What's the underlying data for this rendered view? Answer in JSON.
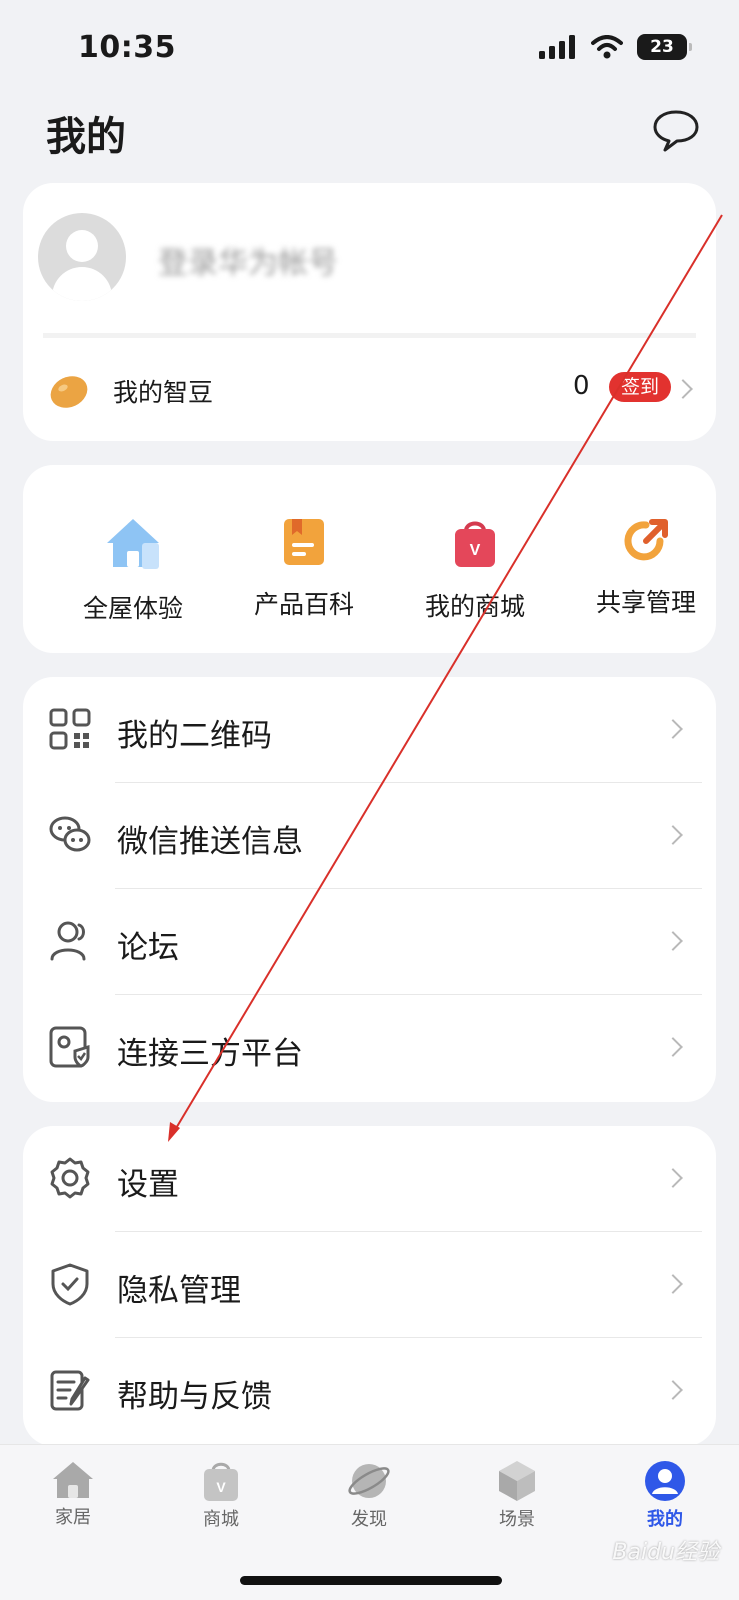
{
  "status_bar": {
    "time": "10:35",
    "battery": "23"
  },
  "header": {
    "title": "我的"
  },
  "profile": {
    "login_text": "登录华为帐号",
    "beans_label": "我的智豆",
    "beans_count": "0",
    "signin_label": "签到"
  },
  "quick_actions": [
    {
      "label": "全屋体验",
      "icon": "house-icon"
    },
    {
      "label": "产品百科",
      "icon": "book-icon"
    },
    {
      "label": "我的商城",
      "icon": "shopping-bag-icon"
    },
    {
      "label": "共享管理",
      "icon": "share-icon"
    }
  ],
  "menu_group_1": [
    {
      "label": "我的二维码",
      "icon": "qr-code-icon"
    },
    {
      "label": "微信推送信息",
      "icon": "wechat-icon"
    },
    {
      "label": "论坛",
      "icon": "users-icon"
    },
    {
      "label": "连接三方平台",
      "icon": "connect-platform-icon"
    }
  ],
  "menu_group_2": [
    {
      "label": "设置",
      "icon": "gear-icon"
    },
    {
      "label": "隐私管理",
      "icon": "shield-icon"
    },
    {
      "label": "帮助与反馈",
      "icon": "edit-icon"
    }
  ],
  "tabs": [
    {
      "label": "家居",
      "icon": "home-icon",
      "active": false
    },
    {
      "label": "商城",
      "icon": "bag-icon",
      "active": false
    },
    {
      "label": "发现",
      "icon": "planet-icon",
      "active": false
    },
    {
      "label": "场景",
      "icon": "cube-icon",
      "active": false
    },
    {
      "label": "我的",
      "icon": "person-icon",
      "active": true
    }
  ],
  "watermark": "Baidu经验",
  "colors": {
    "accent": "#2f58e8",
    "badge": "#e2322f",
    "background": "#f1f2f5",
    "annotation_arrow": "#d9302a"
  }
}
